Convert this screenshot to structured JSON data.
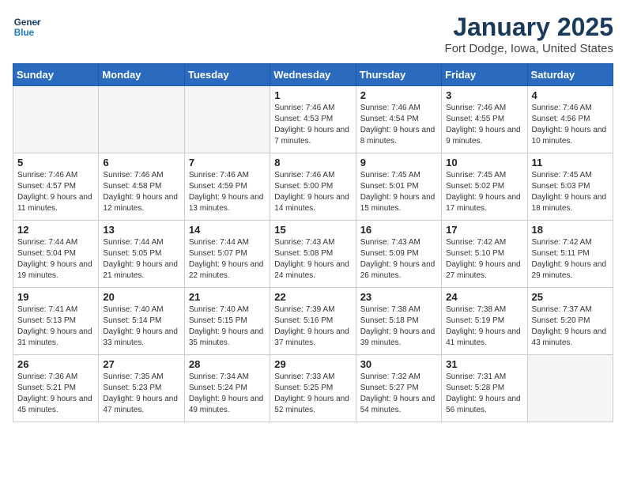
{
  "logo": {
    "line1": "General",
    "line2": "Blue"
  },
  "title": "January 2025",
  "subtitle": "Fort Dodge, Iowa, United States",
  "weekdays": [
    "Sunday",
    "Monday",
    "Tuesday",
    "Wednesday",
    "Thursday",
    "Friday",
    "Saturday"
  ],
  "weeks": [
    [
      {
        "day": "",
        "detail": ""
      },
      {
        "day": "",
        "detail": ""
      },
      {
        "day": "",
        "detail": ""
      },
      {
        "day": "1",
        "detail": "Sunrise: 7:46 AM\nSunset: 4:53 PM\nDaylight: 9 hours and 7 minutes."
      },
      {
        "day": "2",
        "detail": "Sunrise: 7:46 AM\nSunset: 4:54 PM\nDaylight: 9 hours and 8 minutes."
      },
      {
        "day": "3",
        "detail": "Sunrise: 7:46 AM\nSunset: 4:55 PM\nDaylight: 9 hours and 9 minutes."
      },
      {
        "day": "4",
        "detail": "Sunrise: 7:46 AM\nSunset: 4:56 PM\nDaylight: 9 hours and 10 minutes."
      }
    ],
    [
      {
        "day": "5",
        "detail": "Sunrise: 7:46 AM\nSunset: 4:57 PM\nDaylight: 9 hours and 11 minutes."
      },
      {
        "day": "6",
        "detail": "Sunrise: 7:46 AM\nSunset: 4:58 PM\nDaylight: 9 hours and 12 minutes."
      },
      {
        "day": "7",
        "detail": "Sunrise: 7:46 AM\nSunset: 4:59 PM\nDaylight: 9 hours and 13 minutes."
      },
      {
        "day": "8",
        "detail": "Sunrise: 7:46 AM\nSunset: 5:00 PM\nDaylight: 9 hours and 14 minutes."
      },
      {
        "day": "9",
        "detail": "Sunrise: 7:45 AM\nSunset: 5:01 PM\nDaylight: 9 hours and 15 minutes."
      },
      {
        "day": "10",
        "detail": "Sunrise: 7:45 AM\nSunset: 5:02 PM\nDaylight: 9 hours and 17 minutes."
      },
      {
        "day": "11",
        "detail": "Sunrise: 7:45 AM\nSunset: 5:03 PM\nDaylight: 9 hours and 18 minutes."
      }
    ],
    [
      {
        "day": "12",
        "detail": "Sunrise: 7:44 AM\nSunset: 5:04 PM\nDaylight: 9 hours and 19 minutes."
      },
      {
        "day": "13",
        "detail": "Sunrise: 7:44 AM\nSunset: 5:05 PM\nDaylight: 9 hours and 21 minutes."
      },
      {
        "day": "14",
        "detail": "Sunrise: 7:44 AM\nSunset: 5:07 PM\nDaylight: 9 hours and 22 minutes."
      },
      {
        "day": "15",
        "detail": "Sunrise: 7:43 AM\nSunset: 5:08 PM\nDaylight: 9 hours and 24 minutes."
      },
      {
        "day": "16",
        "detail": "Sunrise: 7:43 AM\nSunset: 5:09 PM\nDaylight: 9 hours and 26 minutes."
      },
      {
        "day": "17",
        "detail": "Sunrise: 7:42 AM\nSunset: 5:10 PM\nDaylight: 9 hours and 27 minutes."
      },
      {
        "day": "18",
        "detail": "Sunrise: 7:42 AM\nSunset: 5:11 PM\nDaylight: 9 hours and 29 minutes."
      }
    ],
    [
      {
        "day": "19",
        "detail": "Sunrise: 7:41 AM\nSunset: 5:13 PM\nDaylight: 9 hours and 31 minutes."
      },
      {
        "day": "20",
        "detail": "Sunrise: 7:40 AM\nSunset: 5:14 PM\nDaylight: 9 hours and 33 minutes."
      },
      {
        "day": "21",
        "detail": "Sunrise: 7:40 AM\nSunset: 5:15 PM\nDaylight: 9 hours and 35 minutes."
      },
      {
        "day": "22",
        "detail": "Sunrise: 7:39 AM\nSunset: 5:16 PM\nDaylight: 9 hours and 37 minutes."
      },
      {
        "day": "23",
        "detail": "Sunrise: 7:38 AM\nSunset: 5:18 PM\nDaylight: 9 hours and 39 minutes."
      },
      {
        "day": "24",
        "detail": "Sunrise: 7:38 AM\nSunset: 5:19 PM\nDaylight: 9 hours and 41 minutes."
      },
      {
        "day": "25",
        "detail": "Sunrise: 7:37 AM\nSunset: 5:20 PM\nDaylight: 9 hours and 43 minutes."
      }
    ],
    [
      {
        "day": "26",
        "detail": "Sunrise: 7:36 AM\nSunset: 5:21 PM\nDaylight: 9 hours and 45 minutes."
      },
      {
        "day": "27",
        "detail": "Sunrise: 7:35 AM\nSunset: 5:23 PM\nDaylight: 9 hours and 47 minutes."
      },
      {
        "day": "28",
        "detail": "Sunrise: 7:34 AM\nSunset: 5:24 PM\nDaylight: 9 hours and 49 minutes."
      },
      {
        "day": "29",
        "detail": "Sunrise: 7:33 AM\nSunset: 5:25 PM\nDaylight: 9 hours and 52 minutes."
      },
      {
        "day": "30",
        "detail": "Sunrise: 7:32 AM\nSunset: 5:27 PM\nDaylight: 9 hours and 54 minutes."
      },
      {
        "day": "31",
        "detail": "Sunrise: 7:31 AM\nSunset: 5:28 PM\nDaylight: 9 hours and 56 minutes."
      },
      {
        "day": "",
        "detail": ""
      }
    ]
  ]
}
